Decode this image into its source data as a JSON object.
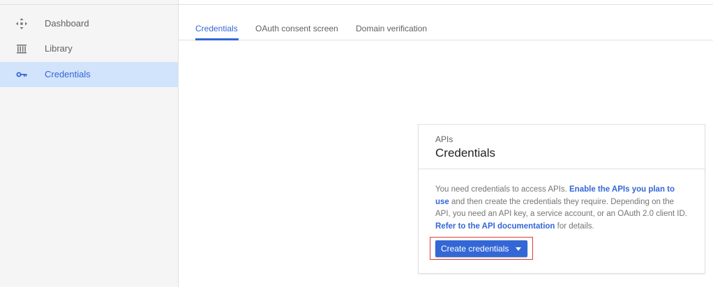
{
  "sidebar": {
    "items": [
      {
        "label": "Dashboard",
        "icon": "dashboard-icon",
        "active": false
      },
      {
        "label": "Library",
        "icon": "library-icon",
        "active": false
      },
      {
        "label": "Credentials",
        "icon": "key-icon",
        "active": true
      }
    ]
  },
  "tabs": [
    {
      "label": "Credentials",
      "active": true
    },
    {
      "label": "OAuth consent screen",
      "active": false
    },
    {
      "label": "Domain verification",
      "active": false
    }
  ],
  "card": {
    "eyebrow": "APIs",
    "title": "Credentials",
    "body": {
      "text_1": "You need credentials to access APIs. ",
      "link_1": "Enable the APIs you plan to use",
      "text_2": " and then create the credentials they require. Depending on the API, you need an API key, a service account, or an OAuth 2.0 client ID. ",
      "link_2": "Refer to the API documentation",
      "text_3": " for details."
    },
    "button_label": "Create credentials"
  },
  "colors": {
    "accent": "#3367d6",
    "active_nav_bg": "#d2e3fc",
    "highlight_border": "#e53935",
    "sidebar_bg": "#f5f5f5"
  }
}
